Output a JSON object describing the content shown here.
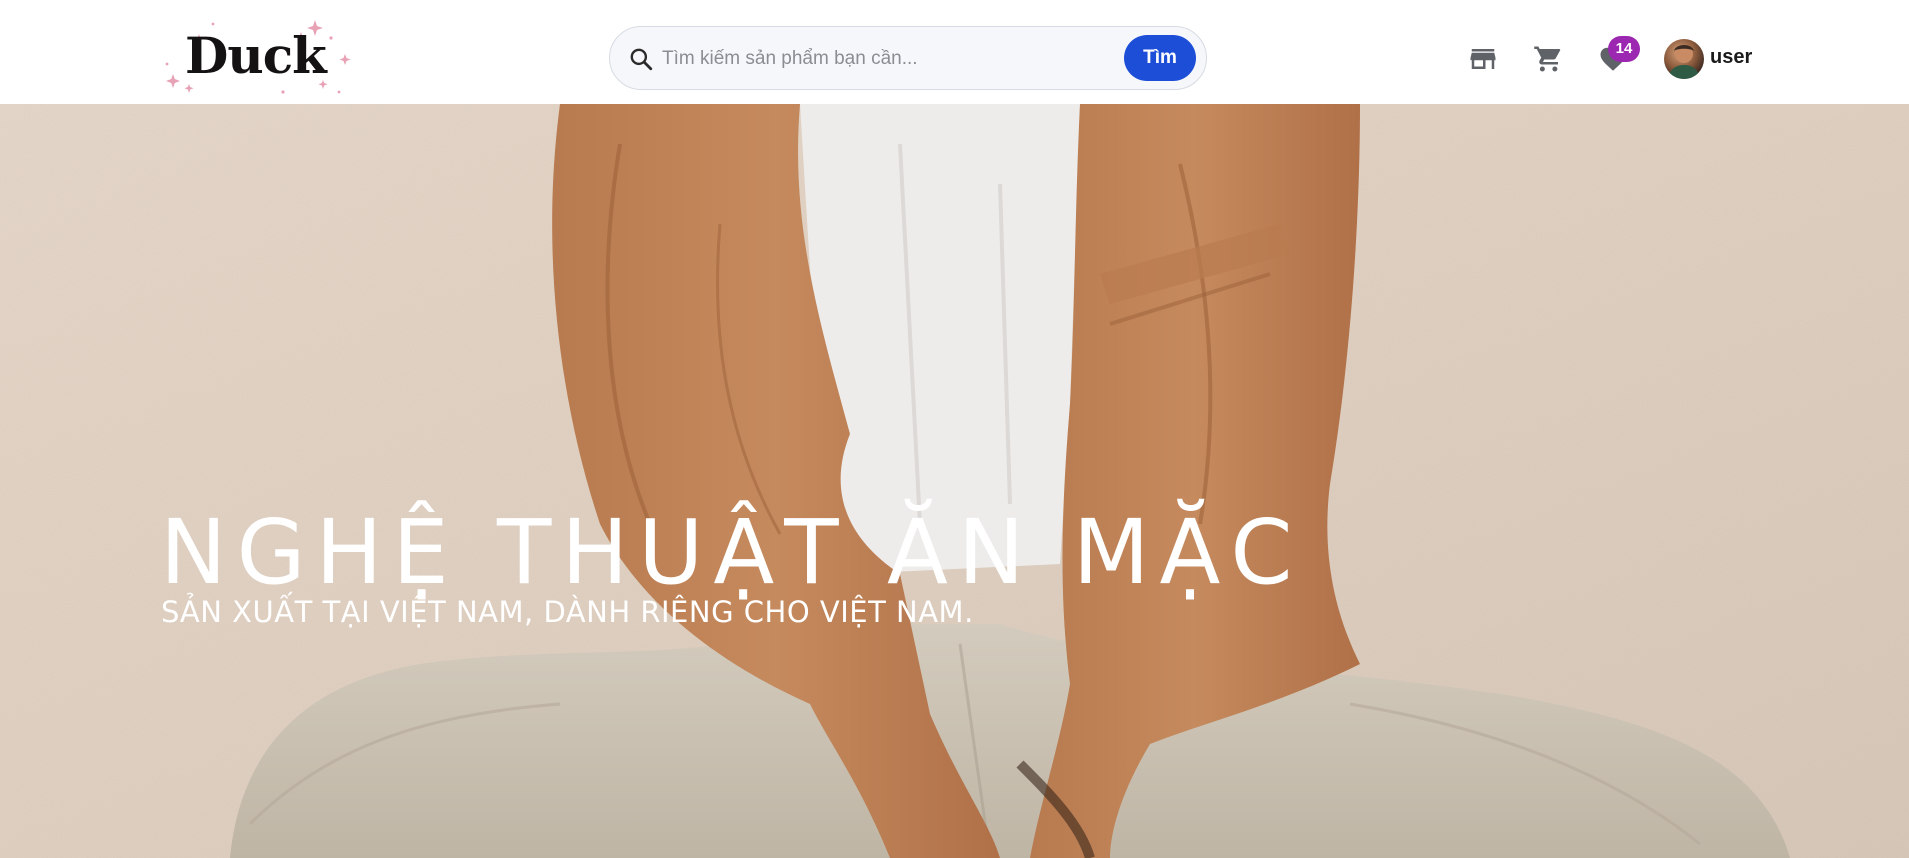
{
  "colors": {
    "accent": "#1d4ed8",
    "badge": "#9c27b0",
    "logo_sparkle": "#e8a2b5",
    "icon_gray": "#5f6368"
  },
  "header": {
    "logo_text": "Duck",
    "search": {
      "placeholder": "Tìm kiếm sản phẩm bạn cần...",
      "value": "",
      "button_label": "Tìm",
      "icon": "search-icon"
    },
    "nav": {
      "store_icon": "store-icon",
      "cart_icon": "cart-icon",
      "wishlist_icon": "heart-icon",
      "wishlist_count": "14"
    },
    "user": {
      "avatar_icon": "avatar",
      "name": "user"
    }
  },
  "hero": {
    "title": "NGHỆ THUẬT ĂN MẶC",
    "subtitle": "SẢN XUẤT TẠI VIỆT NAM, DÀNH RIÊNG CHO VIỆT NAM."
  }
}
